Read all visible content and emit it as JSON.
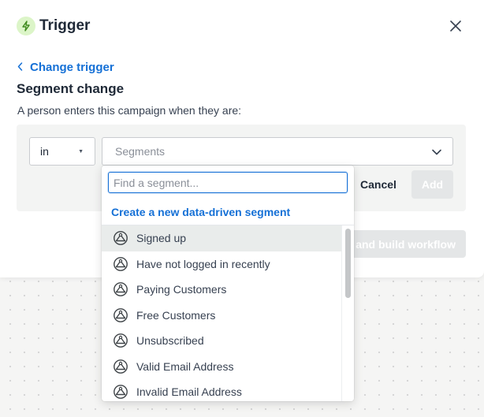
{
  "header": {
    "title": "Trigger",
    "icon": "lightning-icon",
    "close_icon": "close-icon"
  },
  "back_link": "Change trigger",
  "section": {
    "title": "Segment change",
    "description": "A person enters this campaign when they are:"
  },
  "condition": {
    "operator": "in",
    "segments_placeholder": "Segments"
  },
  "actions": {
    "cancel": "Cancel",
    "add": "Add",
    "build": "and build workflow"
  },
  "dropdown": {
    "search_placeholder": "Find a segment...",
    "create_link": "Create a new data-driven segment",
    "items": [
      {
        "label": "Signed up"
      },
      {
        "label": "Have not logged in recently"
      },
      {
        "label": "Paying Customers"
      },
      {
        "label": "Free Customers"
      },
      {
        "label": "Unsubscribed"
      },
      {
        "label": "Valid Email Address"
      },
      {
        "label": "Invalid Email Address"
      }
    ]
  },
  "colors": {
    "accent": "#1570d6",
    "trigger_icon_bg": "#dcf5c8",
    "trigger_icon_fg": "#3f8a1e",
    "disabled_button": "#e4e6e7"
  }
}
